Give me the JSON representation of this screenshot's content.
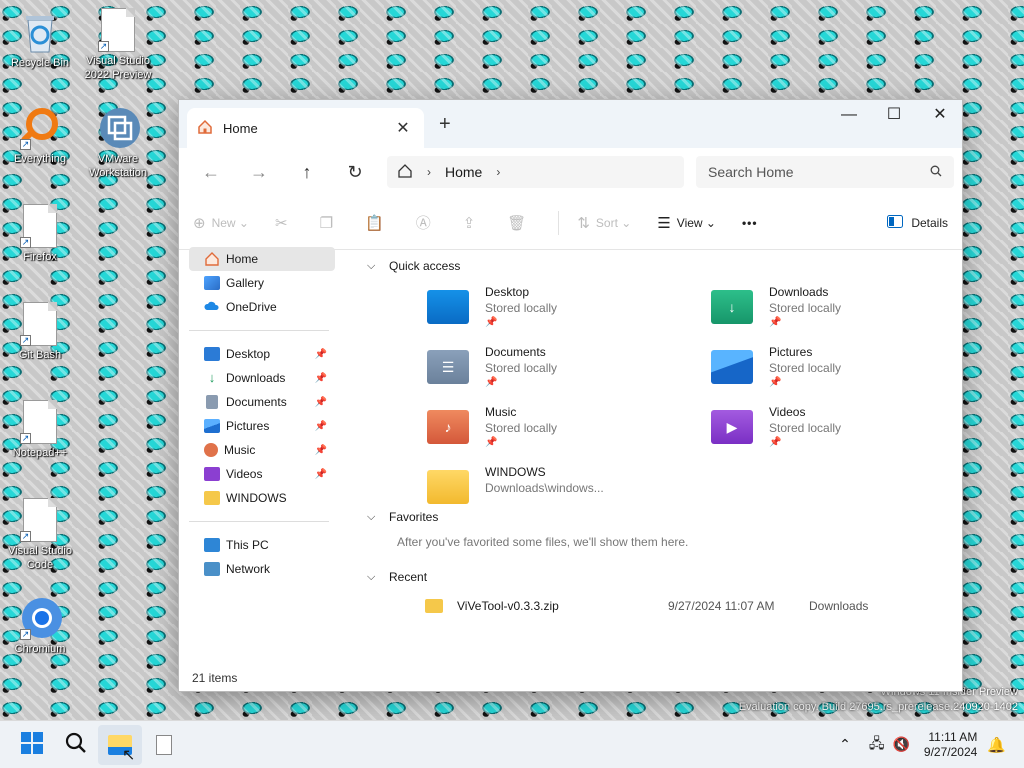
{
  "desktop": {
    "icons": [
      {
        "label": "Recycle Bin"
      },
      {
        "label": "Visual Studio 2022 Preview"
      },
      {
        "label": "Everything"
      },
      {
        "label": "VMware Workstation"
      },
      {
        "label": "Firefox"
      },
      {
        "label": "Git Bash"
      },
      {
        "label": "Notepad++"
      },
      {
        "label": "Visual Studio Code"
      },
      {
        "label": "Chromium"
      }
    ],
    "watermark": {
      "line1": "Windows 11 Insider Preview",
      "line2": "Evaluation copy. Build 27695.rs_prerelease.240920-1402"
    }
  },
  "window": {
    "tab": {
      "label": "Home",
      "close": "✕"
    },
    "new_tab": "+",
    "controls": {
      "minimize": "—",
      "maximize": "☐",
      "close": "✕"
    },
    "nav": {
      "back": "←",
      "forward": "→",
      "up": "↑",
      "refresh": "↻"
    },
    "address": {
      "crumb": "Home",
      "sep": "›"
    },
    "search": {
      "placeholder": "Search Home"
    },
    "command_bar": {
      "new": "New",
      "sort": "Sort",
      "view": "View",
      "more": "•••",
      "details": "Details"
    },
    "sidebar": {
      "home": "Home",
      "gallery": "Gallery",
      "onedrive": "OneDrive",
      "pinned": [
        {
          "label": "Desktop"
        },
        {
          "label": "Downloads"
        },
        {
          "label": "Documents"
        },
        {
          "label": "Pictures"
        },
        {
          "label": "Music"
        },
        {
          "label": "Videos"
        },
        {
          "label": "WINDOWS"
        }
      ],
      "this_pc": "This PC",
      "network": "Network"
    },
    "quick_access": {
      "title": "Quick access",
      "items": [
        {
          "name": "Desktop",
          "sub": "Stored locally"
        },
        {
          "name": "Downloads",
          "sub": "Stored locally"
        },
        {
          "name": "Documents",
          "sub": "Stored locally"
        },
        {
          "name": "Pictures",
          "sub": "Stored locally"
        },
        {
          "name": "Music",
          "sub": "Stored locally"
        },
        {
          "name": "Videos",
          "sub": "Stored locally"
        },
        {
          "name": "WINDOWS",
          "sub": "Downloads\\windows..."
        }
      ]
    },
    "favorites": {
      "title": "Favorites",
      "message": "After you've favorited some files, we'll show them here."
    },
    "recent": {
      "title": "Recent",
      "rows": [
        {
          "name": "ViVeTool-v0.3.3.zip",
          "date": "9/27/2024 11:07 AM",
          "location": "Downloads"
        }
      ]
    },
    "status": "21 items"
  },
  "taskbar": {
    "time": "11:11 AM",
    "date": "9/27/2024"
  },
  "colors": {
    "accent": "#0067c0",
    "window_bg": "#ffffff",
    "tabbar_bg": "#eff4f9",
    "selected_bg": "#e6e6e6"
  }
}
